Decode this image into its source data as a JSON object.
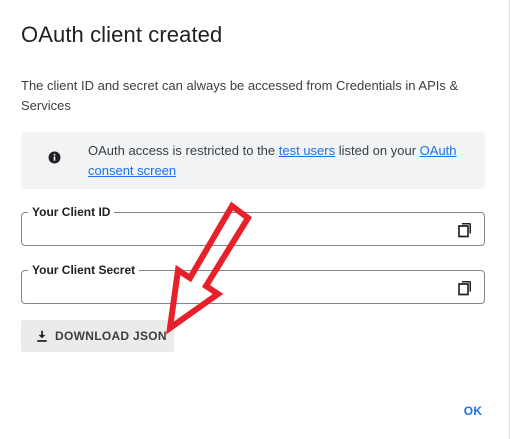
{
  "dialog": {
    "title": "OAuth client created",
    "description": "The client ID and secret can always be accessed from Credentials in APIs & Services"
  },
  "info": {
    "icon": "info-icon",
    "text_before": "OAuth access is restricted to the ",
    "link_test_users": "test users",
    "text_middle": " listed on your ",
    "link_consent_screen": "OAuth consent screen"
  },
  "fields": {
    "client_id": {
      "label": "Your Client ID",
      "value": "",
      "copy_icon": "copy-icon"
    },
    "client_secret": {
      "label": "Your Client Secret",
      "value": "",
      "copy_icon": "copy-icon"
    }
  },
  "actions": {
    "download_label": "DOWNLOAD JSON",
    "download_icon": "download-icon",
    "ok_label": "OK"
  },
  "colors": {
    "link": "#1a73e8",
    "annotation_arrow": "#e8202a",
    "info_background": "#f1f3f4",
    "button_background": "#ebebeb"
  }
}
